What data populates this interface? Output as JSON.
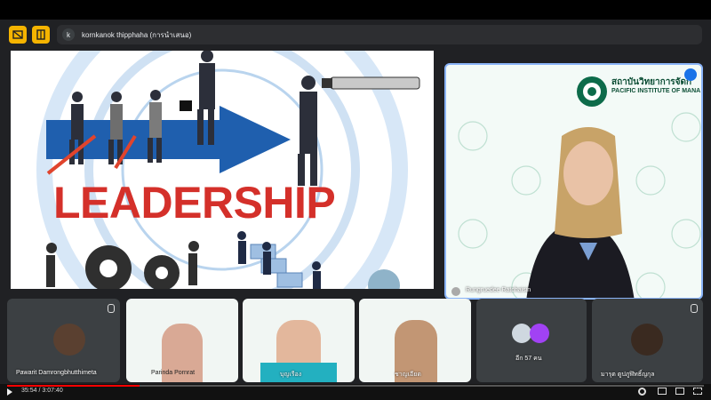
{
  "presenting": {
    "avatar_letter": "k",
    "text": "kornkanok thipphaha (การนำเสนอ)"
  },
  "slide": {
    "title": "LEADERSHIP"
  },
  "speaker": {
    "name": "Rungruedee Ratchaisin",
    "org_thai": "สถาบันวิทยาการจัดก",
    "org_en": "PACIFIC INSTITUTE OF MANA"
  },
  "participants": [
    {
      "name": "Pawarit Damrongbhutthimeta"
    },
    {
      "name": "Parinda Pornrat"
    },
    {
      "name": "บุญเรือง"
    },
    {
      "name": "ชาญเอียด"
    },
    {
      "name": "อีก 57 คน"
    },
    {
      "name": "มารุต ตูปภูฬิทธิ์ญกุล"
    }
  ],
  "player": {
    "time": "35:54 / 3:07:40",
    "progress": 0.19
  }
}
